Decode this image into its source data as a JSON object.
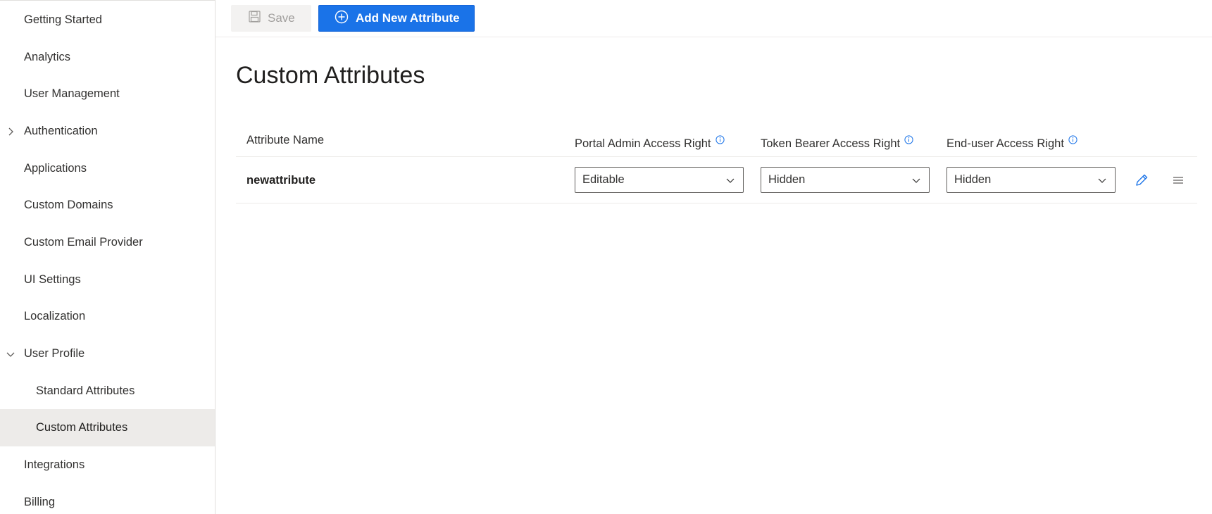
{
  "sidebar": {
    "items": [
      {
        "label": "Getting Started"
      },
      {
        "label": "Analytics"
      },
      {
        "label": "User Management"
      },
      {
        "label": "Authentication",
        "chevron": "chevron-right-icon"
      },
      {
        "label": "Applications"
      },
      {
        "label": "Custom Domains"
      },
      {
        "label": "Custom Email Provider"
      },
      {
        "label": "UI Settings"
      },
      {
        "label": "Localization"
      },
      {
        "label": "User Profile",
        "chevron": "chevron-down-icon"
      },
      {
        "label": "Standard Attributes"
      },
      {
        "label": "Custom Attributes",
        "selected": true
      },
      {
        "label": "Integrations"
      },
      {
        "label": "Billing"
      }
    ]
  },
  "toolbar": {
    "save_label": "Save",
    "save_icon": "floppy-disk-icon",
    "add_label": "Add New Attribute",
    "add_icon": "add-circle-icon"
  },
  "page": {
    "title": "Custom Attributes"
  },
  "table": {
    "columns": {
      "name": "Attribute Name",
      "portal_admin": "Portal Admin Access Right",
      "token_bearer": "Token Bearer Access Right",
      "end_user": "End-user Access Right"
    },
    "rows": [
      {
        "name": "newattribute",
        "portal_admin": "Editable",
        "token_bearer": "Hidden",
        "end_user": "Hidden"
      }
    ]
  },
  "colors": {
    "accent": "#1a73e8",
    "selected_bg": "#edebe9",
    "info_icon": "#1a73e8"
  }
}
